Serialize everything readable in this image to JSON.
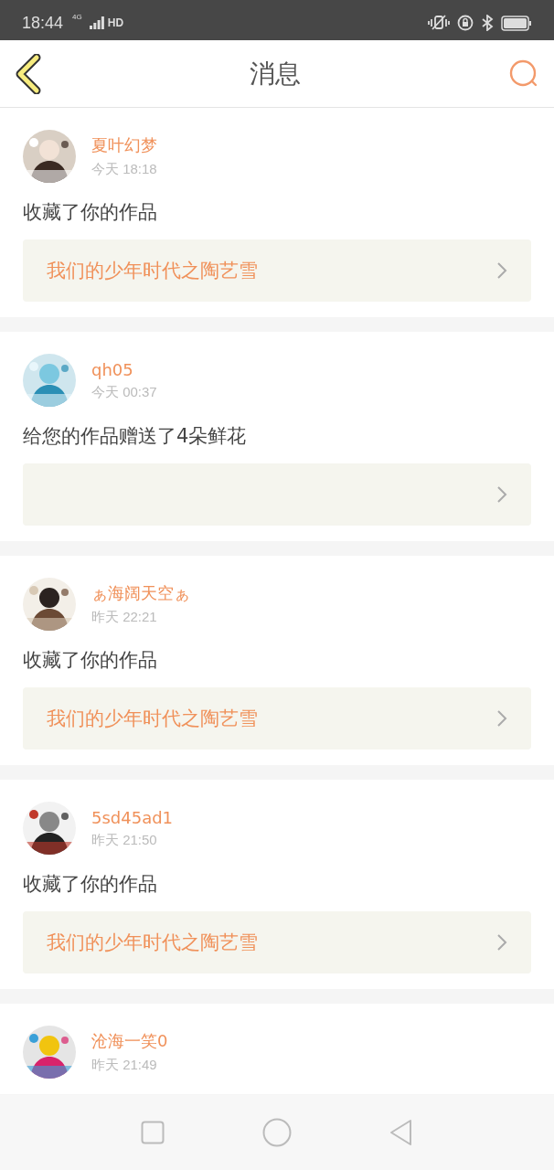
{
  "status_bar": {
    "time": "18:44",
    "network": "4G",
    "hd": "HD"
  },
  "header": {
    "title": "消息"
  },
  "messages": [
    {
      "name": "夏叶幻梦",
      "time": "今天 18:18",
      "action": "收藏了你的作品",
      "work_card": true,
      "work_title": "我们的少年时代之陶艺雪"
    },
    {
      "name": "qh05",
      "time": "今天 00:37",
      "action": "给您的作品赠送了4朵鲜花",
      "work_card": true
    },
    {
      "name": "ぁ海阔天空ぁ",
      "time": "昨天 22:21",
      "action": "收藏了你的作品",
      "work_card": true,
      "work_title": "我们的少年时代之陶艺雪"
    },
    {
      "name": "5sd45ad1",
      "time": "昨天 21:50",
      "action": "收藏了你的作品",
      "work_card": true,
      "work_title": "我们的少年时代之陶艺雪"
    },
    {
      "name": "沧海一笑0",
      "time": "昨天 21:49"
    }
  ]
}
